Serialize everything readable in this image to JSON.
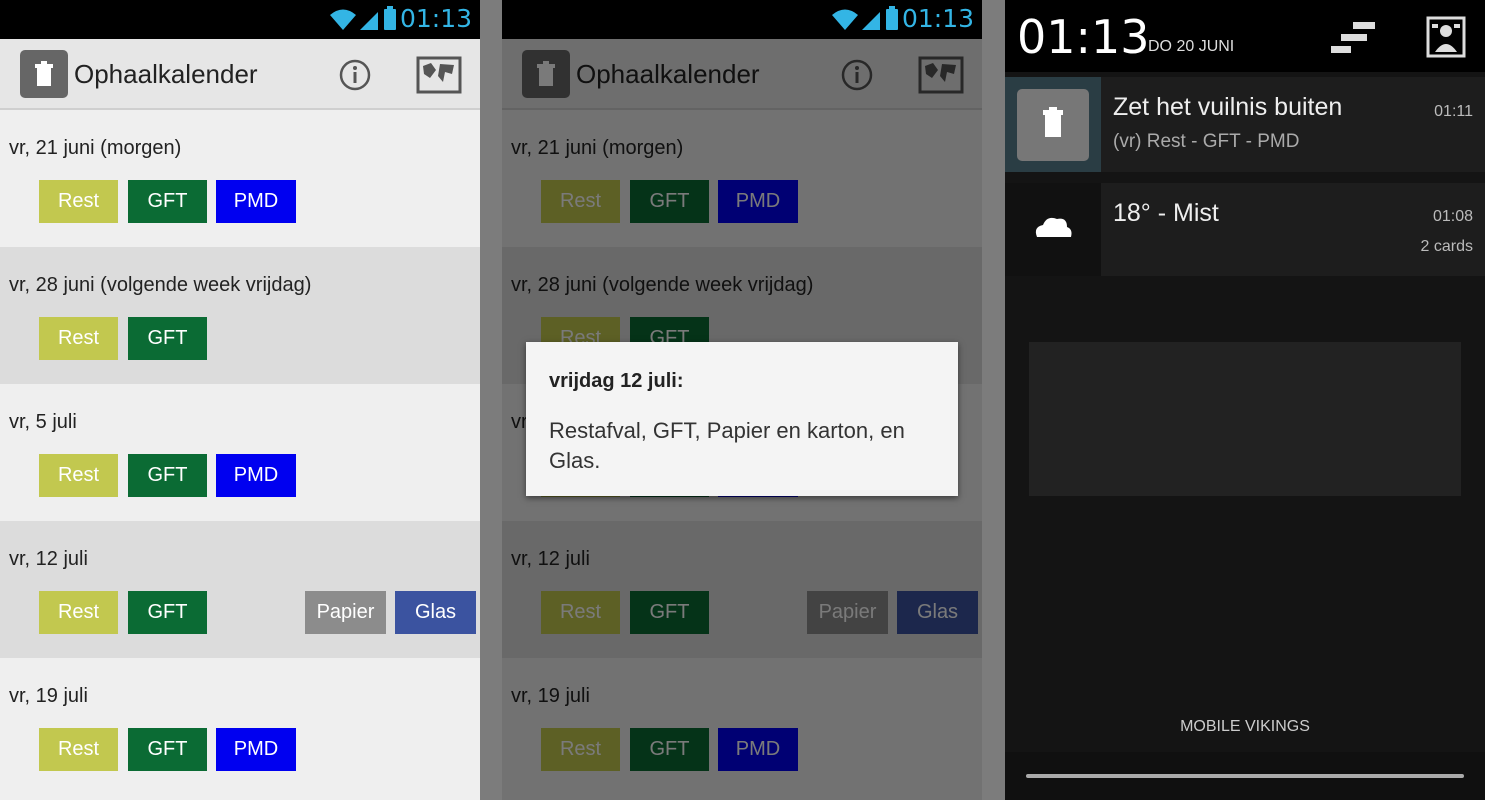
{
  "status": {
    "time": "01:13"
  },
  "app": {
    "title": "Ophaalkalender"
  },
  "days": [
    {
      "label": "vr, 21 juni (morgen)",
      "chips": [
        {
          "type": "rest",
          "text": "Rest"
        },
        {
          "type": "gft",
          "text": "GFT"
        },
        {
          "type": "pmd",
          "text": "PMD"
        }
      ]
    },
    {
      "label": "vr, 28 juni (volgende week vrijdag)",
      "chips": [
        {
          "type": "rest",
          "text": "Rest"
        },
        {
          "type": "gft",
          "text": "GFT"
        }
      ]
    },
    {
      "label": "vr, 5 juli",
      "chips": [
        {
          "type": "rest",
          "text": "Rest"
        },
        {
          "type": "gft",
          "text": "GFT"
        },
        {
          "type": "pmd",
          "text": "PMD"
        }
      ]
    },
    {
      "label": "vr, 12 juli",
      "chips": [
        {
          "type": "rest",
          "text": "Rest"
        },
        {
          "type": "gft",
          "text": "GFT"
        },
        {
          "type": "pap",
          "text": "Papier"
        },
        {
          "type": "glas",
          "text": "Glas"
        }
      ]
    },
    {
      "label": "vr, 19 juli",
      "chips": [
        {
          "type": "rest",
          "text": "Rest"
        },
        {
          "type": "gft",
          "text": "GFT"
        },
        {
          "type": "pmd",
          "text": "PMD"
        }
      ]
    }
  ],
  "dialog": {
    "title": "vrijdag 12 juli:",
    "body": "Restafval, GFT, Papier en karton, en Glas."
  },
  "shade": {
    "time": "01:13",
    "date": "DO 20 JUNI",
    "notifications": [
      {
        "title": "Zet het vuilnis buiten",
        "subtitle": "(vr) Rest - GFT - PMD",
        "time": "01:11",
        "icon": "trash-icon"
      },
      {
        "title": "18° - Mist",
        "subtitle": "",
        "time": "01:08",
        "extra": "2 cards",
        "icon": "cloud-icon"
      }
    ],
    "carrier": "MOBILE VIKINGS"
  },
  "colors": {
    "rest": "#c2c84f",
    "gft": "#0b6b34",
    "pmd": "#0000f0",
    "papier": "#8c8c8c",
    "glas": "#3b53a0",
    "status_accent": "#33b5e5"
  }
}
